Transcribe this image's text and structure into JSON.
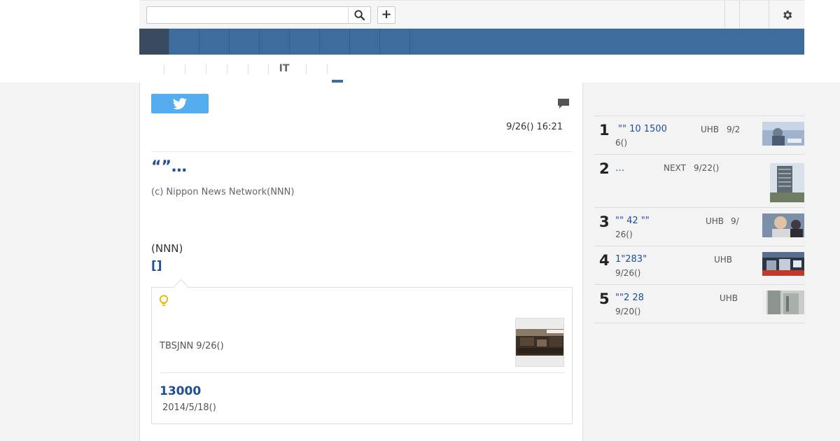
{
  "search": {
    "placeholder": "",
    "value": ""
  },
  "topbar": {
    "add_label": "+"
  },
  "nav": {
    "items": [
      "",
      "",
      "",
      "",
      "",
      "",
      "",
      "",
      ""
    ]
  },
  "subnav": {
    "items": [
      "",
      "",
      "",
      "",
      "",
      "IT",
      "",
      ""
    ]
  },
  "article": {
    "datetime": "9/26() 16:21",
    "headline": "“”…",
    "copyright": "(c) Nippon News Network(NNN)",
    "source": "(NNN)",
    "bracket_link": "[]"
  },
  "related": {
    "first_text": "TBSJNN 9/26()",
    "link_title": "13000",
    "link_date": "2014/5/18()"
  },
  "ranking": [
    {
      "rank": "1",
      "title": "\"\" 10 1500",
      "source": "UHB",
      "date_inline": "9/2",
      "date_wrap": "6()"
    },
    {
      "rank": "2",
      "title": "…",
      "source": "NEXT",
      "date_inline": "9/22()",
      "date_wrap": ""
    },
    {
      "rank": "3",
      "title": "\"\"   42 \"\"",
      "source": "UHB",
      "date_inline": "9/",
      "date_wrap": "26()"
    },
    {
      "rank": "4",
      "title": "  1\"283\"",
      "source": "UHB",
      "date_inline": "",
      "date_wrap": "9/26()"
    },
    {
      "rank": "5",
      "title": " \"\"2  28",
      "source": "UHB",
      "date_inline": "",
      "date_wrap": "9/20()"
    }
  ],
  "colors": {
    "nav": "#3e6d9d",
    "nav_active": "#394a5e",
    "twitter": "#55acee",
    "link": "#1d4e9a",
    "bulb": "#f0b400"
  },
  "icons": [
    "search-icon",
    "plus-icon",
    "gear-icon",
    "twitter-icon",
    "comment-icon",
    "bulb-icon"
  ]
}
